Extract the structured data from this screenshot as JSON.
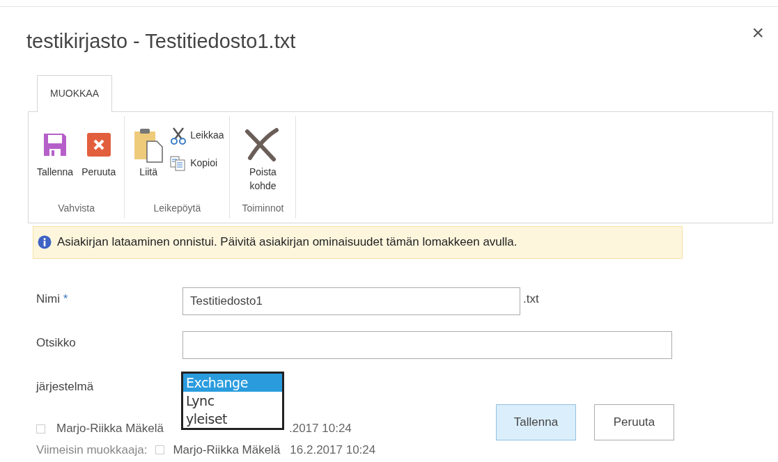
{
  "dialog": {
    "title": "testikirjasto - Testitiedosto1.txt",
    "close": "×"
  },
  "ribbon": {
    "tabs": [
      {
        "label": "MUOKKAA",
        "selected": true
      }
    ],
    "groups": [
      {
        "label": "Vahvista",
        "buttons": [
          {
            "kind": "large",
            "label": "Tallenna"
          },
          {
            "kind": "large",
            "label": "Peruuta"
          }
        ]
      },
      {
        "label": "Leikepöytä",
        "buttons": [
          {
            "kind": "large",
            "label": "Liitä"
          },
          {
            "kind": "small",
            "label": "Leikkaa"
          },
          {
            "kind": "small",
            "label": "Kopioi"
          }
        ]
      },
      {
        "label": "Toiminnot",
        "buttons": [
          {
            "kind": "large",
            "label": "Poista kohde"
          }
        ]
      }
    ]
  },
  "info": "Asiakirjan lataaminen onnistui. Päivitä asiakirjan ominaisuudet tämän lomakkeen avulla.",
  "fields": [
    {
      "kind": "text",
      "label": "Nimi",
      "required_mark": "*",
      "value": "Testitiedosto1",
      "suffix": ".txt"
    },
    {
      "kind": "text",
      "label": "Otsikko"
    },
    {
      "kind": "select",
      "label": "järjestelmä",
      "options": [
        {
          "label": "Exchange",
          "selected": true
        },
        {
          "label": "Lync",
          "selected": false
        },
        {
          "label": "yleiset",
          "selected": false
        }
      ]
    }
  ],
  "created": {
    "person": "Marjo-Riikka Mäkelä",
    "date": ".2017 10:24"
  },
  "modified": {
    "label": "Viimeisin muokkaaja:",
    "person": "Marjo-Riikka Mäkelä",
    "date": "16.2.2017 10:24"
  },
  "buttons": [
    {
      "label": "Tallenna",
      "kind": "primary"
    },
    {
      "label": "Peruuta",
      "kind": "secondary"
    }
  ]
}
